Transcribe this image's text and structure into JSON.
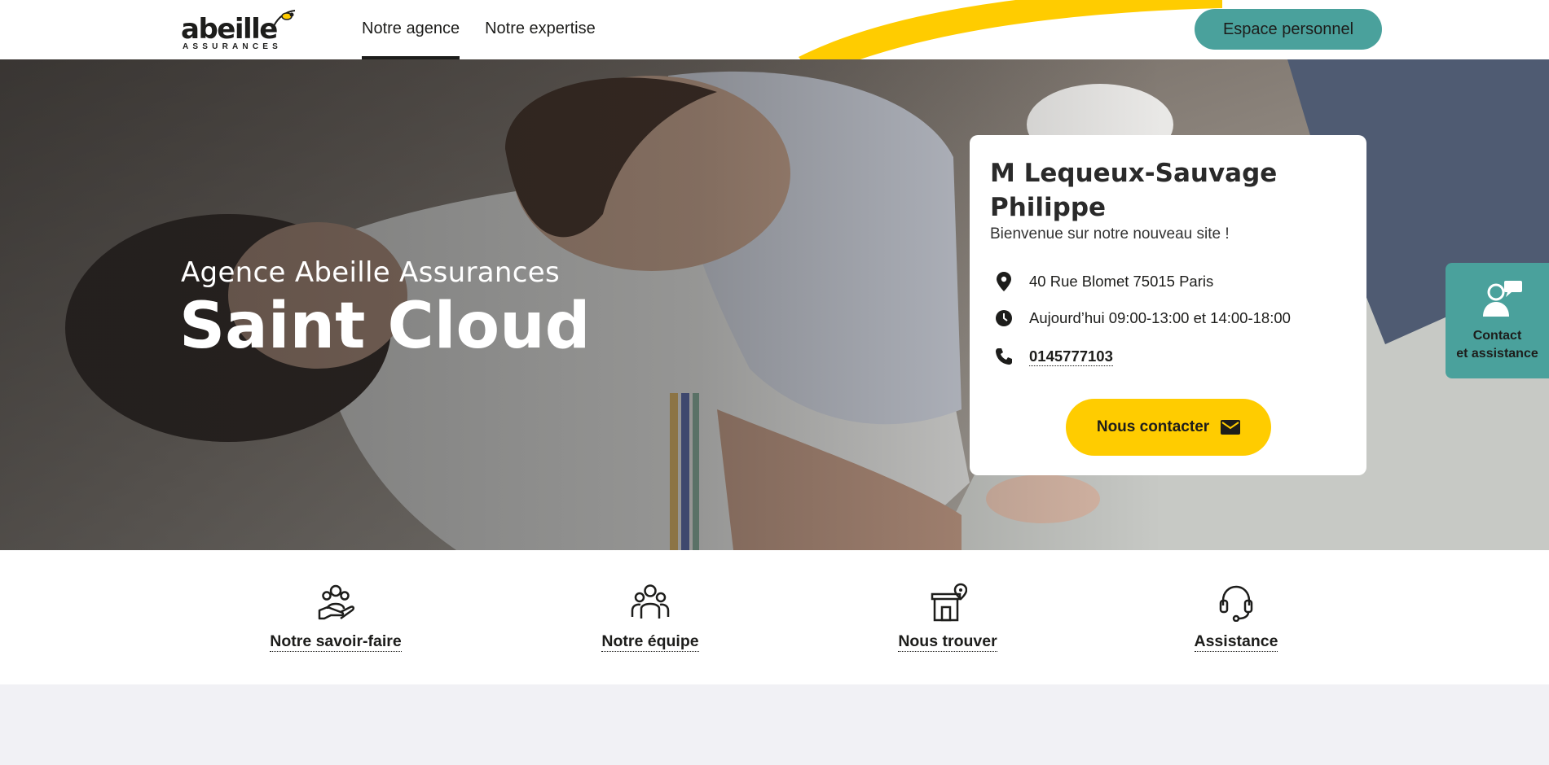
{
  "header": {
    "logo": {
      "word": "abeille",
      "sub": "ASSURANCES"
    },
    "nav": [
      {
        "label": "Notre agence",
        "active": true
      },
      {
        "label": "Notre expertise",
        "active": false
      }
    ],
    "account_button": "Espace personnel"
  },
  "hero": {
    "subtitle": "Agence Abeille Assurances",
    "title": "Saint Cloud"
  },
  "agent_card": {
    "name": "M Lequeux-Sauvage Philippe",
    "welcome": "Bienvenue sur notre nouveau site !",
    "address": "40 Rue Blomet 75015 Paris",
    "hours": "Aujourd’hui 09:00-13:00 et 14:00-18:00",
    "phone": "0145777103",
    "contact_button": "Nous contacter"
  },
  "side_tab": {
    "line1": "Contact",
    "line2": "et assistance"
  },
  "quick_links": [
    {
      "label": "Notre savoir-faire",
      "icon": "hands-people-icon"
    },
    {
      "label": "Notre équipe",
      "icon": "team-icon"
    },
    {
      "label": "Nous trouver",
      "icon": "store-pin-icon"
    },
    {
      "label": "Assistance",
      "icon": "headset-icon"
    }
  ],
  "colors": {
    "brand_yellow": "#ffcc00",
    "brand_teal": "#4aa19c",
    "text_dark": "#1d1d1b",
    "page_bg": "#f1f1f5"
  }
}
